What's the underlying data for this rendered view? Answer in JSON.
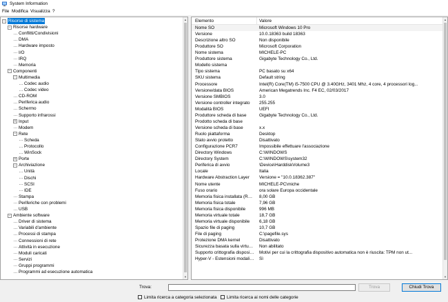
{
  "window": {
    "title": "System Information"
  },
  "menu": [
    "File",
    "Modifica",
    "Visualizza",
    "?"
  ],
  "tree": [
    {
      "label": "Risorse di sistema",
      "level": 0,
      "expander": "minus",
      "selected": true
    },
    {
      "label": "Risorse hardware",
      "level": 1,
      "expander": "minus"
    },
    {
      "label": "Conflitti/Condivisioni",
      "level": 2
    },
    {
      "label": "DMA",
      "level": 2
    },
    {
      "label": "Hardware imposto",
      "level": 2
    },
    {
      "label": "I/O",
      "level": 2
    },
    {
      "label": "IRQ",
      "level": 2
    },
    {
      "label": "Memoria",
      "level": 2
    },
    {
      "label": "Componenti",
      "level": 1,
      "expander": "minus"
    },
    {
      "label": "Multimedia",
      "level": 2,
      "expander": "minus"
    },
    {
      "label": "Codec audio",
      "level": 3
    },
    {
      "label": "Codec video",
      "level": 3
    },
    {
      "label": "CD-ROM",
      "level": 2
    },
    {
      "label": "Periferica audio",
      "level": 2
    },
    {
      "label": "Schermo",
      "level": 2
    },
    {
      "label": "Supporto infrarossi",
      "level": 2
    },
    {
      "label": "Input",
      "level": 2,
      "expander": "plus"
    },
    {
      "label": "Modem",
      "level": 2
    },
    {
      "label": "Rete",
      "level": 2,
      "expander": "minus"
    },
    {
      "label": "Scheda",
      "level": 3
    },
    {
      "label": "Protocollo",
      "level": 3
    },
    {
      "label": "WinSock",
      "level": 3
    },
    {
      "label": "Porte",
      "level": 2,
      "expander": "plus"
    },
    {
      "label": "Archiviazione",
      "level": 2,
      "expander": "minus"
    },
    {
      "label": "Unità",
      "level": 3
    },
    {
      "label": "Dischi",
      "level": 3
    },
    {
      "label": "SCSI",
      "level": 3
    },
    {
      "label": "IDE",
      "level": 3
    },
    {
      "label": "Stampa",
      "level": 2
    },
    {
      "label": "Periferiche con problemi",
      "level": 2
    },
    {
      "label": "USB",
      "level": 2
    },
    {
      "label": "Ambiente software",
      "level": 1,
      "expander": "minus"
    },
    {
      "label": "Driver di sistema",
      "level": 2
    },
    {
      "label": "Variabili d'ambiente",
      "level": 2
    },
    {
      "label": "Processi di stampa",
      "level": 2
    },
    {
      "label": "Connessioni di rete",
      "level": 2
    },
    {
      "label": "Attività in esecuzione",
      "level": 2
    },
    {
      "label": "Moduli caricati",
      "level": 2
    },
    {
      "label": "Servizi",
      "level": 2
    },
    {
      "label": "Gruppi programmi",
      "level": 2
    },
    {
      "label": "Programmi ad esecuzione automatica",
      "level": 2
    }
  ],
  "table": {
    "headers": [
      "Elemento",
      "Valore"
    ],
    "rows": [
      [
        "Nome SO",
        "Microsoft Windows 10 Pro"
      ],
      [
        "Versione",
        "10.0.18363 build 18363"
      ],
      [
        "Descrizione altro SO",
        "Non disponibile"
      ],
      [
        "Produttore SO",
        "Microsoft Corporation"
      ],
      [
        "Nome sistema",
        "MICHELE-PC"
      ],
      [
        "Produttore sistema",
        "Gigabyte Technology Co., Ltd."
      ],
      [
        "Modello sistema",
        ""
      ],
      [
        "Tipo sistema",
        "PC basato su x64"
      ],
      [
        "SKU sistema",
        "Default string"
      ],
      [
        "Processore",
        "Intel(R) Core(TM) i5-7500 CPU @ 3.40GHz, 3401 Mhz, 4 core, 4 processori log..."
      ],
      [
        "Versione/data BIOS",
        "American Megatrends Inc. F4 EC, 02/03/2017"
      ],
      [
        "Versione SMBIOS",
        "3.0"
      ],
      [
        "Versione controller integrato",
        "255.255"
      ],
      [
        "Modalità BIOS",
        "UEFI"
      ],
      [
        "Produttore scheda di base",
        "Gigabyte Technology Co., Ltd."
      ],
      [
        "Prodotto scheda di base",
        ""
      ],
      [
        "Versione scheda di base",
        "x.x"
      ],
      [
        "Ruolo piattaforma",
        "Desktop"
      ],
      [
        "Stato avvio protetto",
        "Disattivato"
      ],
      [
        "Configurazione PCR7",
        "Impossibile effettuare l'associazione"
      ],
      [
        "Directory Windows",
        "C:\\WINDOWS"
      ],
      [
        "Directory System",
        "C:\\WINDOWS\\system32"
      ],
      [
        "Periferica di avvio",
        "\\Device\\HarddiskVolume3"
      ],
      [
        "Locale",
        "Italia"
      ],
      [
        "Hardware Abstraction Layer",
        "Versione = \"10.0.18362.387\""
      ],
      [
        "Nome utente",
        "MICHELE-PC\\miche"
      ],
      [
        "Fuso orario",
        "ora solare Europa occidentale"
      ],
      [
        "Memoria fisica installata (RAM)",
        "8,00 GB"
      ],
      [
        "Memoria fisica totale",
        "7,96 GB"
      ],
      [
        "Memoria fisica disponibile",
        "996 MB"
      ],
      [
        "Memoria virtuale totale",
        "18,7 GB"
      ],
      [
        "Memoria virtuale disponibile",
        "6,18 GB"
      ],
      [
        "Spazio file di paging",
        "10,7 GB"
      ],
      [
        "File di paging",
        "C:\\pagefile.sys"
      ],
      [
        "Protezione DMA kernel",
        "Disattivato"
      ],
      [
        "Sicurezza basata sulla virtualizz...",
        "Non abilitato"
      ],
      [
        "Supporto crittografia dispositivo",
        "Motivi per cui la crittografia dispositivo automatica non è riuscita: TPM non ut..."
      ],
      [
        "Hyper-V - Estensioni modalità ...",
        "Sì"
      ]
    ]
  },
  "find": {
    "label": "Trova:",
    "value": "",
    "find_button": "Trova",
    "close_button": "Chiudi Trova",
    "check_category": "Limita ricerca a categoria selezionata",
    "check_names": "Limita ricerca ai nomi delle categorie"
  }
}
